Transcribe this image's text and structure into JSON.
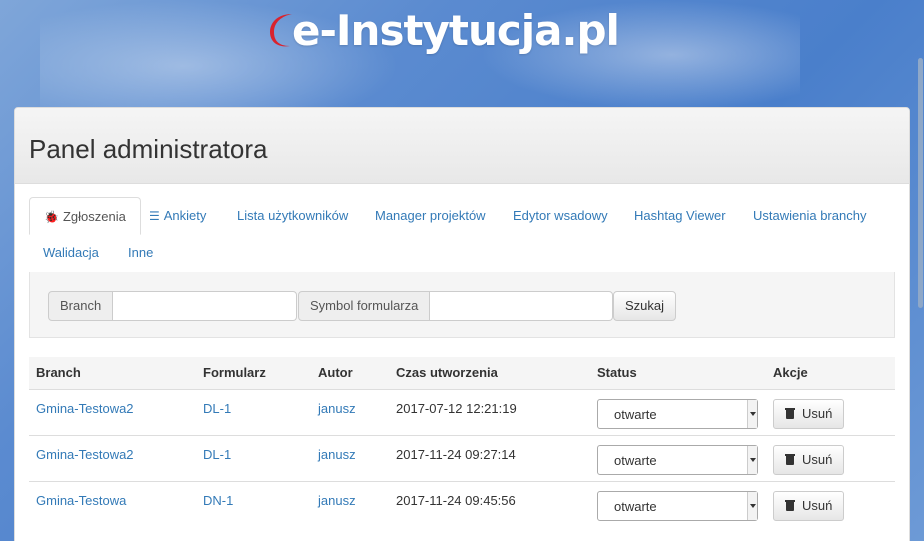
{
  "site": {
    "logo_text": "e-Instytucja.pl"
  },
  "panel": {
    "title": "Panel administratora"
  },
  "tabs": [
    {
      "label": "Zgłoszenia",
      "icon": "bug-icon",
      "active": true
    },
    {
      "label": "Ankiety",
      "icon": "list-icon"
    },
    {
      "label": "Lista użytkowników"
    },
    {
      "label": "Manager projektów"
    },
    {
      "label": "Edytor wsadowy"
    },
    {
      "label": "Hashtag Viewer"
    },
    {
      "label": "Ustawienia branchy"
    },
    {
      "label": "Walidacja"
    },
    {
      "label": "Inne"
    }
  ],
  "search": {
    "branch_label": "Branch",
    "branch_value": "",
    "symbol_label": "Symbol formularza",
    "symbol_value": "",
    "submit_label": "Szukaj"
  },
  "table": {
    "headers": [
      "Branch",
      "Formularz",
      "Autor",
      "Czas utworzenia",
      "Status",
      "Akcje"
    ],
    "rows": [
      {
        "branch": "Gmina-Testowa2",
        "form": "DL-1",
        "author": "janusz",
        "created": "2017-07-12 12:21:19",
        "status": "otwarte",
        "action": "Usuń"
      },
      {
        "branch": "Gmina-Testowa2",
        "form": "DL-1",
        "author": "janusz",
        "created": "2017-11-24 09:27:14",
        "status": "otwarte",
        "action": "Usuń"
      },
      {
        "branch": "Gmina-Testowa",
        "form": "DN-1",
        "author": "janusz",
        "created": "2017-11-24 09:45:56",
        "status": "otwarte",
        "action": "Usuń"
      }
    ]
  },
  "colors": {
    "link": "#337ab7",
    "banner": "#5b8bd0",
    "logo_accent": "#d9232e"
  }
}
